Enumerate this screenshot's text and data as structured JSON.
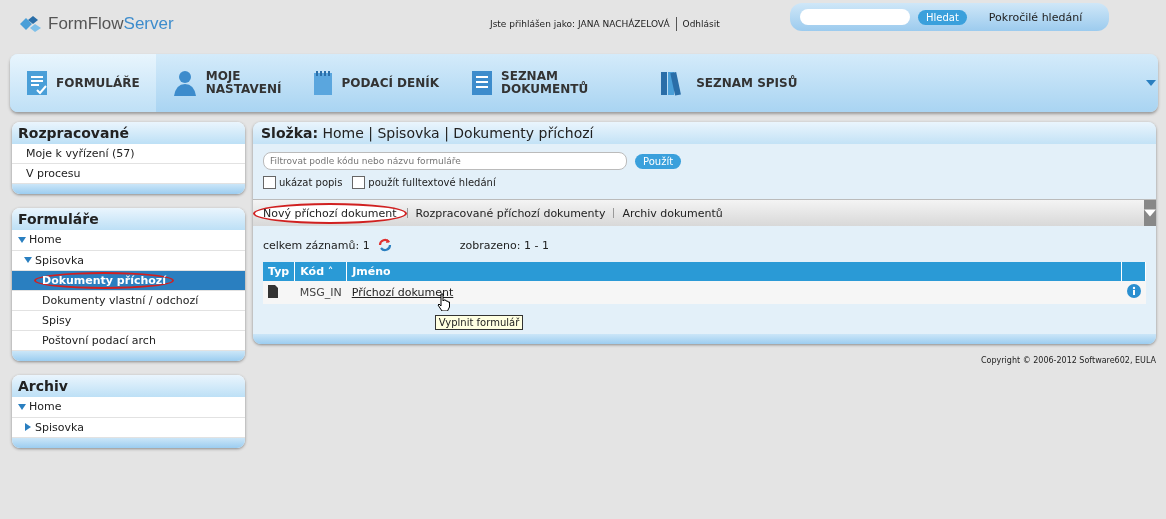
{
  "header": {
    "logo": {
      "brand": "FormFlow",
      "suffix": "Server"
    },
    "login_label": "Jste přihlášen jako: JANA NACHÁZELOVÁ",
    "logout": "Odhlásit",
    "search": {
      "button": "Hledat"
    },
    "advanced_search": "Pokročilé hledání"
  },
  "nav": [
    {
      "label": "FORMULÁŘE",
      "kind": "form",
      "selected": true
    },
    {
      "label": "MOJE\nNASTAVENÍ",
      "kind": "user",
      "selected": false
    },
    {
      "label": "PODACÍ DENÍK",
      "kind": "notebook",
      "selected": false
    },
    {
      "label": "SEZNAM\nDOKUMENTŮ",
      "kind": "list",
      "selected": false
    },
    {
      "label": "SEZNAM SPISŮ",
      "kind": "books",
      "selected": false
    }
  ],
  "sidebar": [
    {
      "title": "Rozpracované",
      "items": [
        {
          "label": "Moje k vyřízení (57)",
          "selected": false,
          "annotated": false
        },
        {
          "label": "V procesu",
          "selected": false,
          "annotated": false
        }
      ]
    },
    {
      "title": "Formuláře",
      "tree": [
        {
          "label": "Home",
          "expanded": true,
          "children": [
            {
              "label": "Spisovka",
              "expanded": true,
              "children": [
                {
                  "label": "Dokumenty příchozí",
                  "selected": true,
                  "annotated": true
                },
                {
                  "label": "Dokumenty vlastní / odchozí",
                  "selected": false,
                  "annotated": false
                },
                {
                  "label": "Spisy",
                  "selected": false,
                  "annotated": false
                },
                {
                  "label": "Poštovní podací arch",
                  "selected": false,
                  "annotated": false
                }
              ]
            }
          ]
        }
      ]
    },
    {
      "title": "Archiv",
      "tree": [
        {
          "label": "Home",
          "expanded": true,
          "children": [
            {
              "label": "Spisovka",
              "expanded": false
            }
          ]
        }
      ]
    }
  ],
  "main": {
    "folder_label": "Složka:",
    "breadcrumb": "Home | Spisovka | Dokumenty příchozí",
    "filter": {
      "placeholder": "Filtrovat podle kódu nebo názvu formuláře",
      "button": "Použít"
    },
    "options": [
      {
        "label": "ukázat popis",
        "checked": false
      },
      {
        "label": "použít fulltextové hledání",
        "checked": false
      }
    ],
    "tabs": [
      {
        "label": "Nový příchozí dokument",
        "selected": true,
        "annotated": true
      },
      {
        "label": "Rozpracované příchozí dokumenty",
        "selected": false,
        "annotated": false
      },
      {
        "label": "Archiv dokumentů",
        "selected": false,
        "annotated": false
      }
    ],
    "total": "celkem záznamů: 1",
    "shown": "zobrazeno: 1 - 1",
    "table": {
      "columns": [
        "Typ",
        "Kód ˄",
        "Jméno"
      ],
      "rows": [
        {
          "code": "MSG_IN",
          "name": "Příchozí dokument"
        }
      ]
    },
    "tooltip": "Vyplnit formulář"
  },
  "footer": "Copyright © 2006-2012 Software602, EULA"
}
